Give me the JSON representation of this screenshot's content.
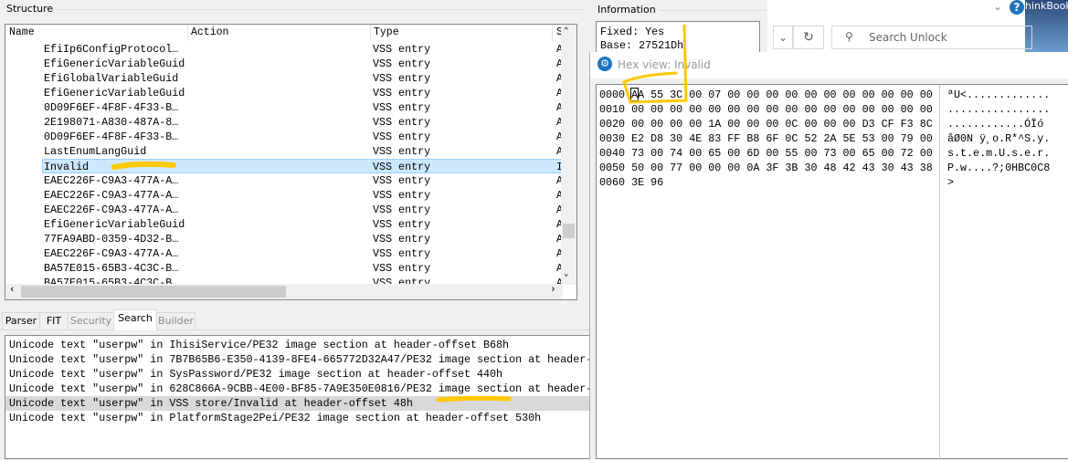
{
  "structure": {
    "title": "Structure",
    "columns": [
      "Name",
      "Action",
      "Type",
      "S"
    ],
    "rows": [
      {
        "name": "EfiIp6ConfigProtocol…",
        "type": "VSS entry",
        "s": "A"
      },
      {
        "name": "EfiGenericVariableGuid",
        "type": "VSS entry",
        "s": "A"
      },
      {
        "name": "EfiGlobalVariableGuid",
        "type": "VSS entry",
        "s": "A"
      },
      {
        "name": "EfiGenericVariableGuid",
        "type": "VSS entry",
        "s": "A"
      },
      {
        "name": "0D09F6EF-4F8F-4F33-B…",
        "type": "VSS entry",
        "s": "A"
      },
      {
        "name": "2E198071-A830-487A-8…",
        "type": "VSS entry",
        "s": "A"
      },
      {
        "name": "0D09F6EF-4F8F-4F33-B…",
        "type": "VSS entry",
        "s": "A"
      },
      {
        "name": "LastEnumLangGuid",
        "type": "VSS entry",
        "s": "A"
      },
      {
        "name": "Invalid",
        "type": "VSS entry",
        "s": "I"
      },
      {
        "name": "EAEC226F-C9A3-477A-A…",
        "type": "VSS entry",
        "s": "A"
      },
      {
        "name": "EAEC226F-C9A3-477A-A…",
        "type": "VSS entry",
        "s": "A"
      },
      {
        "name": "EAEC226F-C9A3-477A-A…",
        "type": "VSS entry",
        "s": "A"
      },
      {
        "name": "EfiGenericVariableGuid",
        "type": "VSS entry",
        "s": "A"
      },
      {
        "name": "77FA9ABD-0359-4D32-B…",
        "type": "VSS entry",
        "s": "A"
      },
      {
        "name": "EAEC226F-C9A3-477A-A…",
        "type": "VSS entry",
        "s": "A"
      },
      {
        "name": "BA57E015-65B3-4C3C-B…",
        "type": "VSS entry",
        "s": "A"
      },
      {
        "name": "BA57E015-65B3-4C3C-B…",
        "type": "VSS entry",
        "s": "A"
      }
    ]
  },
  "tabs": [
    "Parser",
    "FIT",
    "Security",
    "Search",
    "Builder"
  ],
  "search_results": [
    "Unicode text \"userpw\" in IhisiService/PE32 image section at header-offset B68h",
    "Unicode text \"userpw\" in 7B7B65B6-E350-4139-8FE4-665772D32A47/PE32 image section at header-",
    "Unicode text \"userpw\" in SysPassword/PE32 image section at header-offset 440h",
    "Unicode text \"userpw\" in 628C866A-9CBB-4E00-BF85-7A9E350E0816/PE32 image section at header-",
    "Unicode text \"userpw\" in VSS store/Invalid at header-offset 48h",
    "Unicode text \"userpw\" in PlatformStage2Pei/PE32 image section at header-offset 530h"
  ],
  "information": {
    "title": "Information",
    "lines": [
      "Fixed: Yes",
      "Base: 27521Dh"
    ]
  },
  "explorer": {
    "search_placeholder": "Search Unlock",
    "corner_text": "hinkBook"
  },
  "hexview": {
    "title": "Hex view: Invalid",
    "offsets": [
      "0000",
      "0010",
      "0020",
      "0030",
      "0040",
      "0050",
      "0060"
    ],
    "hex": [
      "AA 55 3C 00 07 00 00 00 00 00 00 00 00 00 00 00",
      "00 00 00 00 00 00 00 00 00 00 00 00 00 00 00 00",
      "00 00 00 00 1A 00 00 00 0C 00 00 00 D3 CF F3 8C",
      "E2 D8 30 4E 83 FF B8 6F 0C 52 2A 5E 53 00 79 00",
      "73 00 74 00 65 00 6D 00 55 00 73 00 65 00 72 00",
      "50 00 77 00 00 00 0A 3F 3B 30 48 42 43 30 43 38",
      "3E 96"
    ],
    "ascii": [
      "ªU<.............",
      "................",
      "............ÓÏó",
      "âØ0N ÿ¸o.R*^S.y.",
      "s.t.e.m.U.s.e.r.",
      "P.w....?;0HBC0C8",
      ">"
    ]
  },
  "colors": {
    "selection": "#cce8ff",
    "highlight": "#ffc800",
    "accent": "#1e73be"
  }
}
